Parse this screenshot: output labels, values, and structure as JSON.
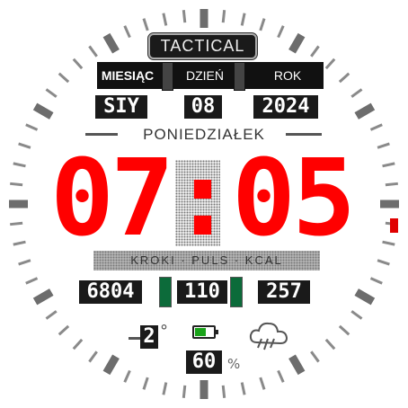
{
  "brand": {
    "label": "TACTICAL"
  },
  "date": {
    "headers": [
      "MIESIĄC",
      "DZIEŃ",
      "ROK"
    ],
    "month": "SIY",
    "day": "08",
    "year": "2024",
    "weekday": "PONIEDZIAŁEK"
  },
  "time": {
    "hours": "07",
    "colon": ":",
    "minutes": "05"
  },
  "stats": {
    "labels_text": "KROKI · PULS · KCAL",
    "steps": "6804",
    "heart_rate": "110",
    "calories": "257"
  },
  "weather": {
    "temperature": "2",
    "unit": "°",
    "icon": "cloud-rain-icon"
  },
  "battery": {
    "value": "60",
    "unit": "%",
    "icon": "battery-icon",
    "level": 0.6
  },
  "colors": {
    "time": "#ff0000",
    "accent": "#0c6b3a",
    "box": "#1a1a1a",
    "marker": "#e00000"
  }
}
